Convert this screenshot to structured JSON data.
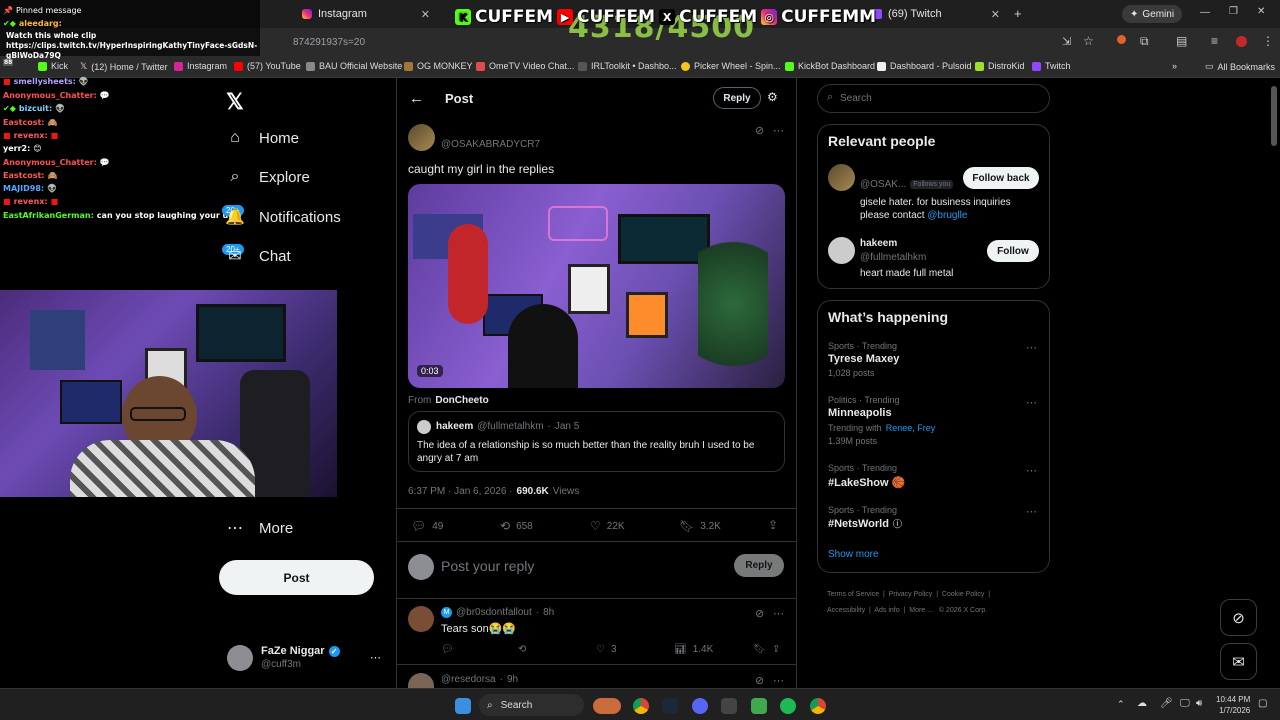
{
  "browser": {
    "tabs": [
      {
        "label": "Instagram"
      },
      {
        "label": "(69) Twitch"
      }
    ],
    "url_fragment": "874291937s=20",
    "bookmarks": [
      "Kick",
      "(12) Home / Twitter",
      "Instagram",
      "(57) YouTube",
      "BAU Official Website",
      "OG MONKEY",
      "OmeTV Video Chat...",
      "IRLToolkit • Dashbo...",
      "Picker Wheel - Spin...",
      "KickBot Dashboard",
      "Dashboard - Pulsoid",
      "DistroKid",
      "Twitch"
    ],
    "all_bookmarks": "All Bookmarks",
    "gemini": "Gemini"
  },
  "overlay": {
    "banner": [
      "CUFFEM",
      "CUFFEM",
      "CUFFEM",
      "CUFFEMM"
    ],
    "counter": "4318/4500"
  },
  "chat": {
    "pinned_label": "Pinned message",
    "pinned_user": "aleedarg:",
    "pinned_text": "Watch this whole clip https://clips.twitch.tv/HyperInspiringKathyTinyFace-sGdsN-gBlWoDa79Q",
    "lines": [
      {
        "user": "smellysheets:",
        "msg": ""
      },
      {
        "user": "Anonymous_Chatter:",
        "msg": ""
      },
      {
        "user": "bizcuit:",
        "msg": ""
      },
      {
        "user": "Eastcost:",
        "msg": ""
      },
      {
        "user": "revenx:",
        "msg": ""
      },
      {
        "user": "yerr2:",
        "msg": ""
      },
      {
        "user": "Anonymous_Chatter:",
        "msg": ""
      },
      {
        "user": "Eastcost:",
        "msg": ""
      },
      {
        "user": "MAJID98:",
        "msg": ""
      },
      {
        "user": "revenx:",
        "msg": ""
      },
      {
        "user": "EastAfrikanGerman:",
        "msg": "can you stop laughing your ugly"
      }
    ]
  },
  "sidebar": {
    "nav": [
      {
        "label": "Home",
        "icon": "home-icon"
      },
      {
        "label": "Explore",
        "icon": "search-icon"
      },
      {
        "label": "Notifications",
        "icon": "bell-icon",
        "badge": "20+"
      },
      {
        "label": "Chat",
        "icon": "chat-icon",
        "badge": "20+"
      },
      {
        "label": "More",
        "icon": "more-icon"
      }
    ],
    "post_button": "Post",
    "account": {
      "name": "FaZe Niggar",
      "handle": "@cuff3m"
    }
  },
  "post": {
    "header": "Post",
    "reply_button": "Reply",
    "author": "@OSAKABRADYCR7",
    "text": "caught my girl in the replies",
    "video_time": "0:03",
    "from_label": "From",
    "from_name": "DonCheeto",
    "quote": {
      "name": "hakeem",
      "handle": "@fullmetalhkm",
      "date": "Jan 5",
      "text": "The idea of a relationship is so much better than the reality bruh I used to be angry at 7 am"
    },
    "timestamp": "6:37 PM · Jan 6, 2026 ·",
    "views": "690.6K",
    "views_label": "Views",
    "stats": {
      "replies": "49",
      "reposts": "658",
      "likes": "22K",
      "bookmarks": "3.2K"
    },
    "reply_placeholder": "Post your reply",
    "reply_submit": "Reply"
  },
  "replies": [
    {
      "handle": "@br0sdontfallout",
      "time": "8h",
      "text": "Tears son😭😭",
      "likes": "3",
      "views": "1.4K"
    },
    {
      "handle": "@resedorsa",
      "time": "9h"
    }
  ],
  "right": {
    "search_placeholder": "Search",
    "relevant_title": "Relevant people",
    "people": [
      {
        "name": "",
        "handle": "@OSAK...",
        "follows_you": "Follows you",
        "bio": "gisele hater. for business inquiries please contact",
        "bio_link": "@bruglle",
        "button": "Follow back"
      },
      {
        "name": "hakeem",
        "handle": "@fullmetalhkm",
        "bio": "heart made full metal",
        "button": "Follow"
      }
    ],
    "happening_title": "What’s happening",
    "trends": [
      {
        "meta": "Sports · Trending",
        "title": "Tyrese Maxey",
        "count": "1,028 posts"
      },
      {
        "meta": "Politics · Trending",
        "title": "Minneapolis",
        "with_label": "Trending with",
        "with_names": "Renee, Frey",
        "count": "1.39M posts"
      },
      {
        "meta": "Sports · Trending",
        "title": "#LakeShow 🏀"
      },
      {
        "meta": "Sports · Trending",
        "title": "#NetsWorld"
      }
    ],
    "show_more": "Show more",
    "footer": [
      "Terms of Service",
      "Privacy Policy",
      "Cookie Policy",
      "Accessibility",
      "Ads info",
      "More ...",
      "© 2026 X Corp."
    ]
  },
  "taskbar": {
    "search": "Search",
    "time": "10:44 PM",
    "date": "1/7/2026"
  }
}
